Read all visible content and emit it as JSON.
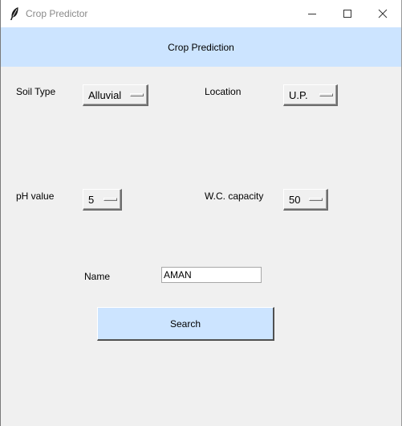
{
  "window": {
    "title": "Crop Predictor",
    "icon": "feather-icon"
  },
  "banner": {
    "text": "Crop Prediction"
  },
  "form": {
    "soil_type": {
      "label": "Soil Type",
      "value": "Alluvial"
    },
    "location": {
      "label": "Location",
      "value": "U.P."
    },
    "ph": {
      "label": "pH value",
      "value": "5"
    },
    "wc_capacity": {
      "label": "W.C. capacity",
      "value": "50"
    },
    "name": {
      "label": "Name",
      "value": "AMAN"
    }
  },
  "search_button": {
    "label": "Search"
  },
  "colors": {
    "accent": "#cce4ff",
    "background": "#f0f0f0"
  }
}
